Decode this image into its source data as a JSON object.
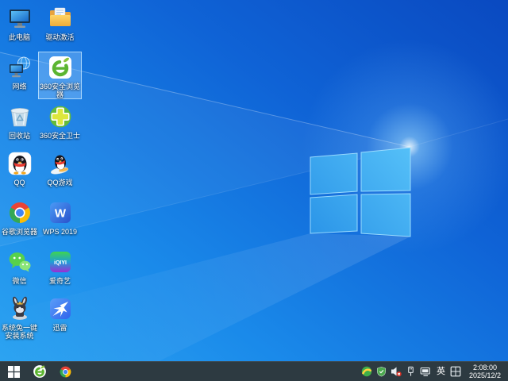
{
  "desktop": {
    "icons": [
      {
        "name": "this-pc",
        "label": "此电脑",
        "selected": false
      },
      {
        "name": "driver-activate",
        "label": "驱动激活",
        "selected": false
      },
      {
        "name": "network",
        "label": "网络",
        "selected": false
      },
      {
        "name": "360-safe-browser",
        "label": "360安全浏览器",
        "selected": true
      },
      {
        "name": "recycle-bin",
        "label": "回收站",
        "selected": false
      },
      {
        "name": "360-safeguard",
        "label": "360安全卫士",
        "selected": false
      },
      {
        "name": "qq",
        "label": "QQ",
        "selected": false
      },
      {
        "name": "qq-games",
        "label": "QQ游戏",
        "selected": false
      },
      {
        "name": "chrome",
        "label": "谷歌浏览器",
        "selected": false
      },
      {
        "name": "wps",
        "label": "WPS 2019",
        "selected": false
      },
      {
        "name": "wechat",
        "label": "微信",
        "selected": false
      },
      {
        "name": "iqiyi",
        "label": "爱奇艺",
        "selected": false
      },
      {
        "name": "system-rabbit-installer",
        "label": "系统兔一键安装系统",
        "selected": false
      },
      {
        "name": "thunder",
        "label": "迅雷",
        "selected": false
      }
    ]
  },
  "taskbar": {
    "pinned_icons": [
      "start",
      "360-safe-browser",
      "chrome"
    ],
    "tray": {
      "icons": [
        "360-tray",
        "security-shield",
        "volume-muted",
        "usb-device",
        "network-status",
        "language-indicator",
        "ime-grid"
      ],
      "language": "英",
      "time": "2:08:00",
      "date": "2025/12/2"
    }
  },
  "colors": {
    "wallpaper_light": "#2ea6f2",
    "wallpaper_dark": "#0a49c0",
    "taskbar": "#2d3a41",
    "selection": "rgba(132,192,250,0.45)"
  }
}
